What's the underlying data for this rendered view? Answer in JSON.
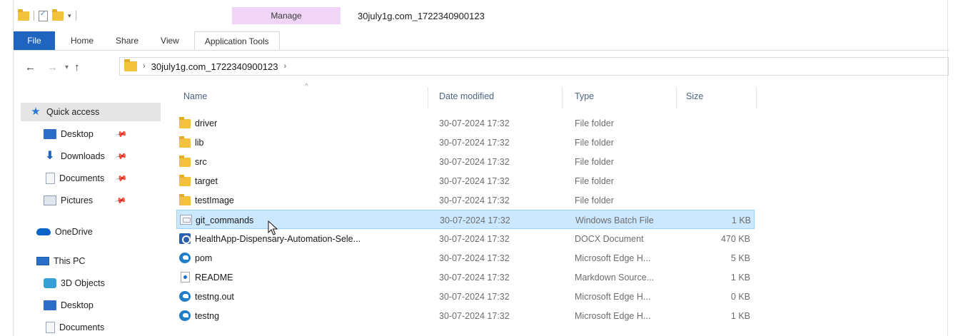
{
  "window": {
    "title": "30july1g.com_1722340900123",
    "contextual_tab_group": "Manage"
  },
  "ribbon": {
    "tabs": [
      "File",
      "Home",
      "Share",
      "View",
      "Application Tools"
    ]
  },
  "address": {
    "path_segment": "30july1g.com_1722340900123"
  },
  "nav_pane": {
    "quick_access": "Quick access",
    "items": [
      {
        "label": "Desktop",
        "icon": "desktop-icon",
        "pinned": true
      },
      {
        "label": "Downloads",
        "icon": "download-arrow-icon",
        "pinned": true
      },
      {
        "label": "Documents",
        "icon": "document-icon",
        "pinned": true
      },
      {
        "label": "Pictures",
        "icon": "pictures-icon",
        "pinned": true
      }
    ],
    "onedrive": "OneDrive",
    "this_pc": "This PC",
    "pc_items": [
      {
        "label": "3D Objects",
        "icon": "3d-objects-icon"
      },
      {
        "label": "Desktop",
        "icon": "desktop-icon"
      },
      {
        "label": "Documents",
        "icon": "document-icon"
      }
    ]
  },
  "columns": {
    "name": "Name",
    "date": "Date modified",
    "type": "Type",
    "size": "Size"
  },
  "files": [
    {
      "name": "driver",
      "date": "30-07-2024 17:32",
      "type": "File folder",
      "size": "",
      "icon": "folder-icon"
    },
    {
      "name": "lib",
      "date": "30-07-2024 17:32",
      "type": "File folder",
      "size": "",
      "icon": "folder-icon"
    },
    {
      "name": "src",
      "date": "30-07-2024 17:32",
      "type": "File folder",
      "size": "",
      "icon": "folder-icon"
    },
    {
      "name": "target",
      "date": "30-07-2024 17:32",
      "type": "File folder",
      "size": "",
      "icon": "folder-icon"
    },
    {
      "name": "testImage",
      "date": "30-07-2024 17:32",
      "type": "File folder",
      "size": "",
      "icon": "folder-icon"
    },
    {
      "name": "git_commands",
      "date": "30-07-2024 17:32",
      "type": "Windows Batch File",
      "size": "1 KB",
      "icon": "batch-file-icon",
      "selected": true
    },
    {
      "name": "HealthApp-Dispensary-Automation-Sele...",
      "date": "30-07-2024 17:32",
      "type": "DOCX Document",
      "size": "470 KB",
      "icon": "docx-icon"
    },
    {
      "name": "pom",
      "date": "30-07-2024 17:32",
      "type": "Microsoft Edge H...",
      "size": "5 KB",
      "icon": "edge-icon"
    },
    {
      "name": "README",
      "date": "30-07-2024 17:32",
      "type": "Markdown Source...",
      "size": "1 KB",
      "icon": "markdown-icon"
    },
    {
      "name": "testng.out",
      "date": "30-07-2024 17:32",
      "type": "Microsoft Edge H...",
      "size": "0 KB",
      "icon": "edge-icon"
    },
    {
      "name": "testng",
      "date": "30-07-2024 17:32",
      "type": "Microsoft Edge H...",
      "size": "1 KB",
      "icon": "edge-icon"
    }
  ]
}
